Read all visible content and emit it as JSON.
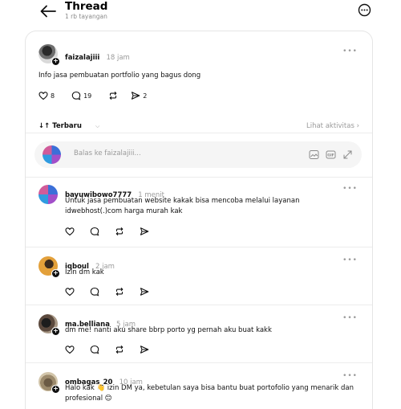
{
  "header": {
    "title": "Thread",
    "views": "1 rb tayangan"
  },
  "post": {
    "username": "faizalajiii",
    "time": "18 jam",
    "text": "Info jasa pembuatan portfolio yang bagus dong",
    "likes": "8",
    "comments": "19",
    "shares": "2"
  },
  "sort": {
    "label": "Terbaru",
    "activity": "Lihat aktivitas"
  },
  "reply": {
    "placeholder": "Balas ke faizalajiii..."
  },
  "comments": [
    {
      "username": "bayuwibowo7777",
      "time": "1 menit",
      "text": "Untuk jasa pembuatan website kakak bisa mencoba melalui layanan idwebhost(.)com harga murah kak"
    },
    {
      "username": "iqboul",
      "time": "2 jam",
      "text": "Izin dm kak"
    },
    {
      "username": "ma.belliana",
      "time": "5 jam",
      "text": "dm me! nanti aku share bbrp porto yg pernah aku buat kakk"
    },
    {
      "username": "ombagas_20",
      "time": "10 jam",
      "text": "Halo kak 👋 izin DM ya, kebetulan saya bisa bantu buat portofolio yang menarik dan profesional 😊"
    }
  ],
  "icons": {
    "back": "arrow-left-icon",
    "more": "more-circle-icon",
    "like": "heart-icon",
    "comment": "comment-icon",
    "repost": "repost-icon",
    "share": "send-icon",
    "sort": "sort-icon",
    "gif": "gif-icon",
    "image": "image-icon",
    "expand": "expand-icon"
  },
  "colors": {
    "text": "#101010",
    "muted": "#9a9a9a",
    "divider": "#ececec",
    "reply_bg": "#f5f5f5"
  }
}
